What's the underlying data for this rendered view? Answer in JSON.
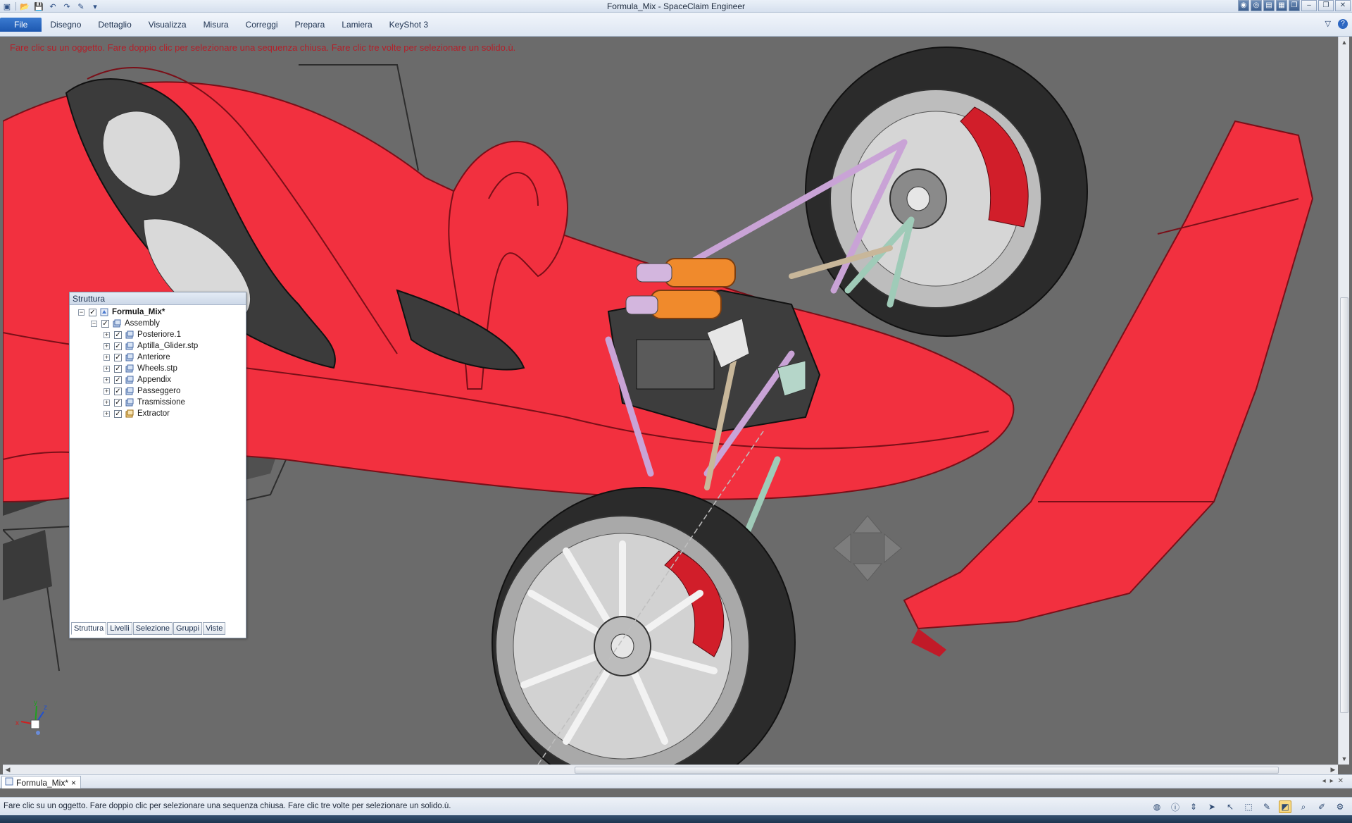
{
  "window": {
    "title": "Formula_Mix - SpaceClaim Engineer"
  },
  "qat": {
    "icons": [
      "app-icon",
      "open-icon",
      "save-icon",
      "undo-icon",
      "redo-icon",
      "select-tool-icon",
      "customize-icon"
    ]
  },
  "ribbon": {
    "tabs": [
      "File",
      "Disegno",
      "Dettaglio",
      "Visualizza",
      "Misura",
      "Correggi",
      "Prepara",
      "Lamiera",
      "KeyShot 3"
    ]
  },
  "viewport": {
    "hint": "Fare clic su un oggetto. Fare doppio clic per selezionare una sequenza chiusa. Fare clic tre volte per selezionare un solido.ù.",
    "axis_labels": {
      "x": "x",
      "y": "y",
      "z": "z"
    }
  },
  "structure_panel": {
    "title": "Struttura",
    "root": "Formula_Mix*",
    "assembly": "Assembly",
    "items": [
      "Posteriore.1",
      "Aptilla_Glider.stp",
      "Anteriore",
      "Wheels.stp",
      "Appendix",
      "Passeggero",
      "Trasmissione",
      "Extractor"
    ],
    "tabs": [
      "Struttura",
      "Livelli",
      "Selezione",
      "Gruppi",
      "Viste"
    ]
  },
  "document_tab": {
    "label": "Formula_Mix*",
    "close": "×"
  },
  "status": {
    "text": "Fare clic su un oggetto. Fare doppio clic per selezionare una sequenza chiusa. Fare clic tre volte per selezionare un solido.ù."
  },
  "colors": {
    "body_red": "#f2303f",
    "viewport_bg": "#6b6b6b",
    "suspension_purple": "#c9a3d6",
    "suspension_green": "#9fcbb8",
    "spring_orange": "#f08a2c",
    "caliper_red": "#d11e2a",
    "tire_dark": "#2b2b2b",
    "hint_red": "#b3202a",
    "file_tab_blue": "#1d58b0"
  }
}
